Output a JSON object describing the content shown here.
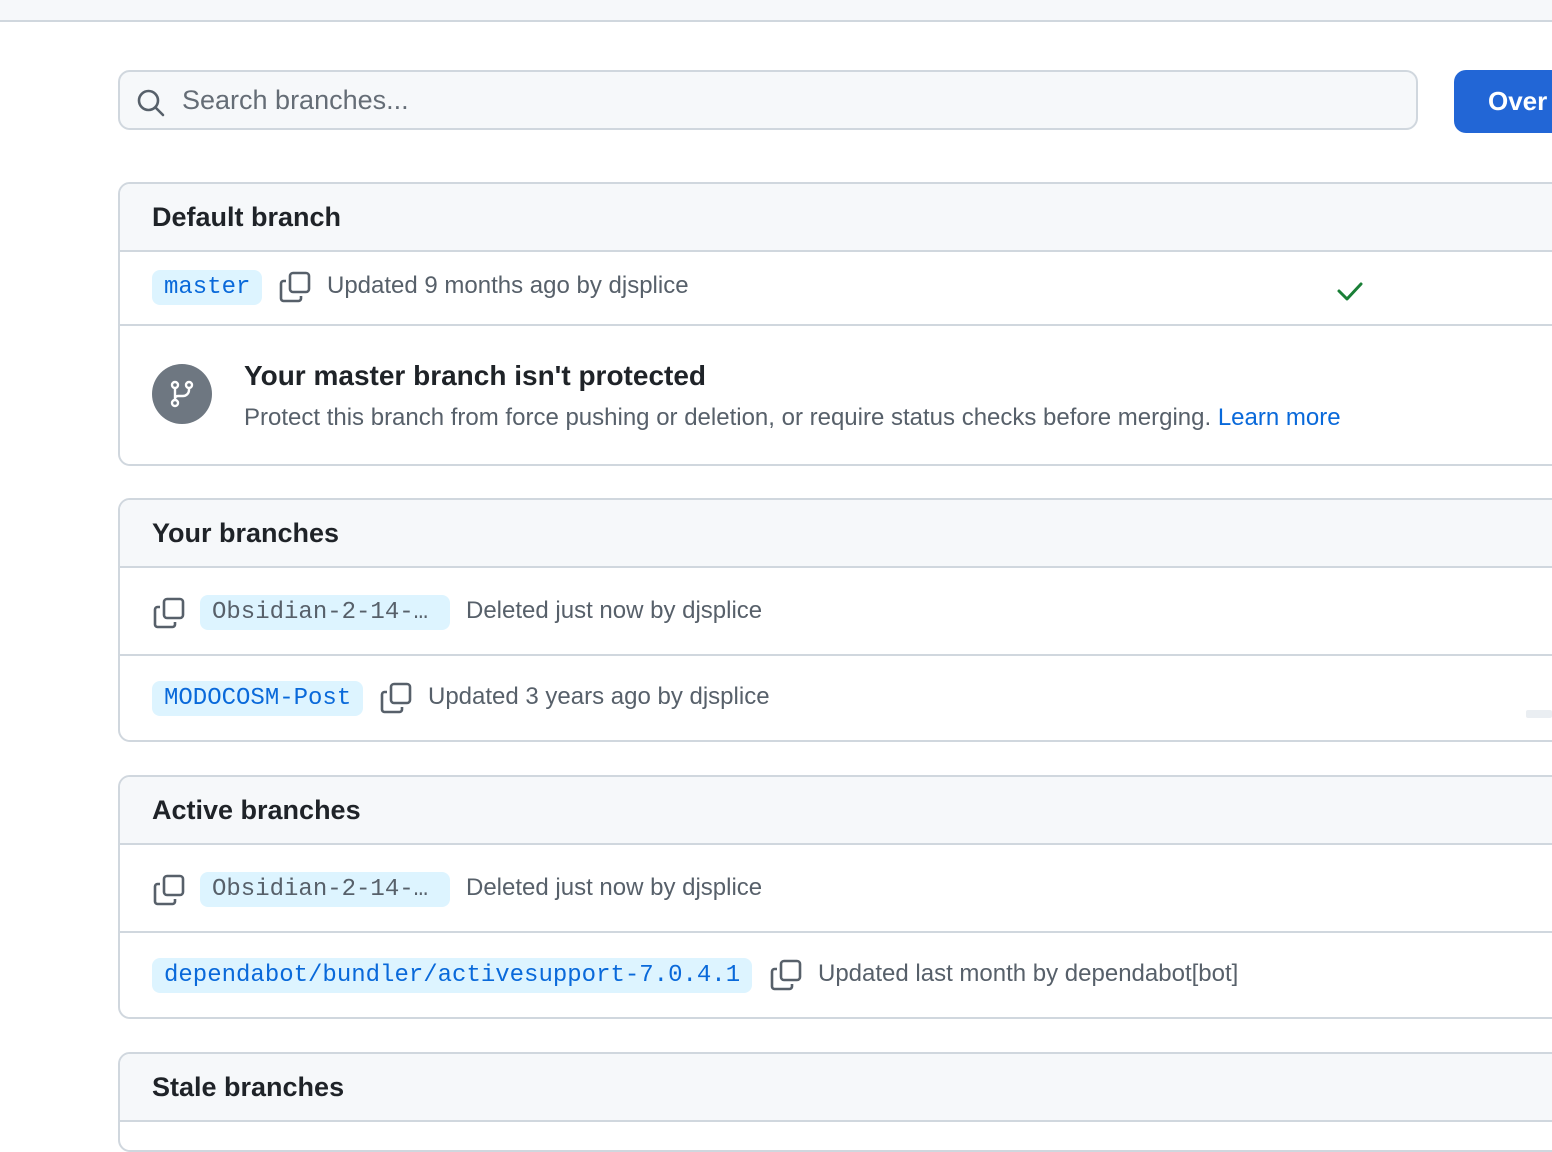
{
  "search": {
    "placeholder": "Search branches..."
  },
  "new_branch_button": {
    "label": "Over"
  },
  "default_section": {
    "title": "Default branch",
    "row": {
      "branch": "master",
      "meta": "Updated 9 months ago by djsplice",
      "status_icon": "check-icon",
      "status_color": "#1a7f37"
    },
    "protection": {
      "title": "Your master branch isn't protected",
      "description": "Protect this branch from force pushing or deletion, or require status checks before merging.",
      "link": "Learn more",
      "icon": "git-branch-icon"
    }
  },
  "your_section": {
    "title": "Your branches",
    "rows": [
      {
        "branch": "Obsidian-2-14-…",
        "meta": "Deleted just now by djsplice"
      },
      {
        "branch": "MODOCOSM-Post",
        "meta": "Updated 3 years ago by djsplice"
      }
    ]
  },
  "active_section": {
    "title": "Active branches",
    "rows": [
      {
        "branch": "Obsidian-2-14-…",
        "meta": "Deleted just now by djsplice"
      },
      {
        "branch": "dependabot/bundler/activesupport-7.0.4.1",
        "meta": "Updated last month by dependabot[bot]"
      }
    ]
  },
  "stale_section": {
    "title": "Stale branches"
  },
  "colors": {
    "accent": "#0969da",
    "button": "#2266d6",
    "branch_bg": "#ddf4ff",
    "border": "#d0d7de"
  }
}
